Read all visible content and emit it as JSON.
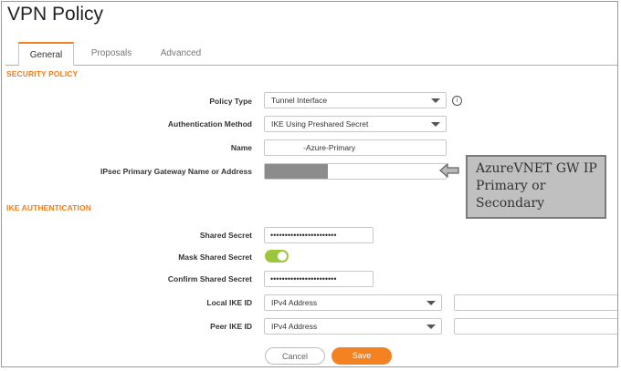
{
  "window": {
    "title": "VPN Policy"
  },
  "tabs": [
    {
      "label": "General",
      "active": true
    },
    {
      "label": "Proposals",
      "active": false
    },
    {
      "label": "Advanced",
      "active": false
    }
  ],
  "security_policy": {
    "heading": "SECURITY POLICY",
    "policy_type": {
      "label": "Policy Type",
      "value": "Tunnel Interface"
    },
    "auth_method": {
      "label": "Authentication Method",
      "value": "IKE Using Preshared Secret"
    },
    "name": {
      "label": "Name",
      "value": "-Azure-Primary"
    },
    "gateway": {
      "label": "IPsec Primary Gateway Name or Address",
      "value": ""
    }
  },
  "ike_auth": {
    "heading": "IKE AUTHENTICATION",
    "shared_secret": {
      "label": "Shared Secret",
      "value": "•••••••••••••••••••••••"
    },
    "mask_shared_secret": {
      "label": "Mask Shared Secret",
      "enabled": true
    },
    "confirm_shared_secret": {
      "label": "Confirm Shared Secret",
      "value": "•••••••••••••••••••••••"
    },
    "local_ike_id": {
      "label": "Local IKE ID",
      "type": "IPv4 Address",
      "value": ""
    },
    "peer_ike_id": {
      "label": "Peer IKE ID",
      "type": "IPv4 Address",
      "value": ""
    }
  },
  "actions": {
    "cancel_label": "Cancel",
    "save_label": "Save"
  },
  "annotation": {
    "line1": "AzureVNET GW IP",
    "line2": "Primary or",
    "line3": "Secondary"
  },
  "colors": {
    "accent": "#f58220",
    "toggle_on": "#9cc63b",
    "callout_bg": "#c0c0c0"
  },
  "icons": {
    "info": "info-icon",
    "arrow": "arrow-left-icon",
    "dropdown": "chevron-down-icon"
  }
}
